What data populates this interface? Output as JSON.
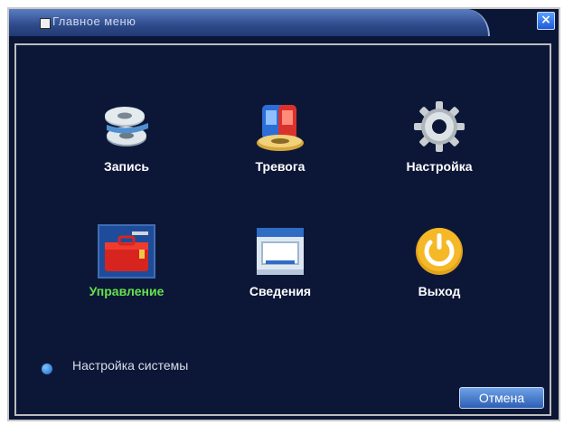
{
  "window": {
    "title": "Главное меню",
    "close_symbol": "×"
  },
  "menu": {
    "items": [
      {
        "label": "Запись",
        "icon": "record-film-icon",
        "active": false
      },
      {
        "label": "Тревога",
        "icon": "alarm-icon",
        "active": false
      },
      {
        "label": "Настройка",
        "icon": "settings-gear-icon",
        "active": false
      },
      {
        "label": "Управление",
        "icon": "management-toolbox-icon",
        "active": true
      },
      {
        "label": "Сведения",
        "icon": "info-window-icon",
        "active": false
      },
      {
        "label": "Выход",
        "icon": "power-exit-icon",
        "active": false
      }
    ]
  },
  "status": {
    "text": "Настройка системы"
  },
  "buttons": {
    "cancel_label": "Отмена"
  },
  "colors": {
    "background": "#0b1636",
    "active_label": "#66e24a",
    "title_bar": "#2e4a8a"
  }
}
